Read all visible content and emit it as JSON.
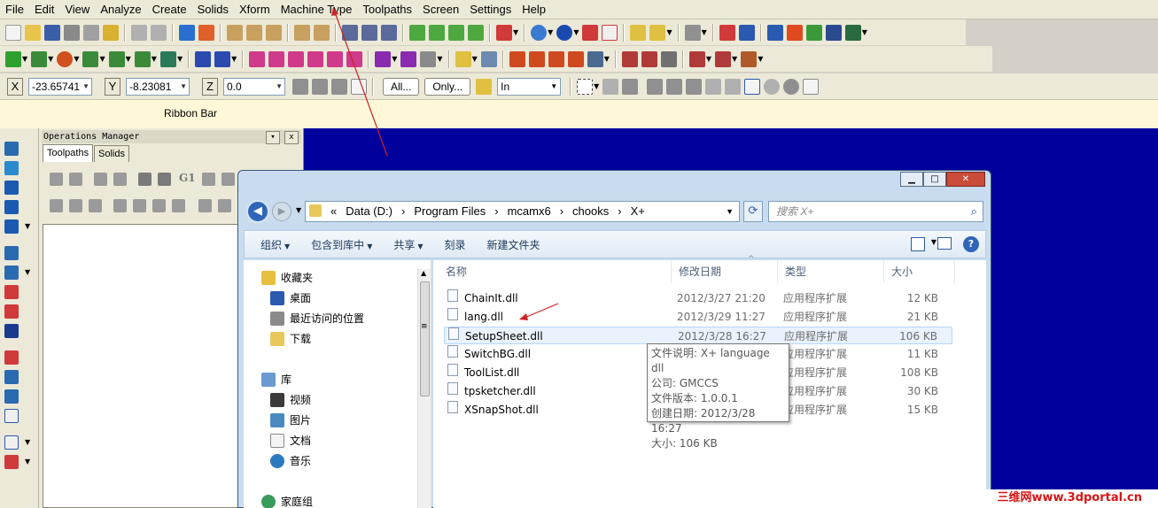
{
  "menubar": [
    "File",
    "Edit",
    "View",
    "Analyze",
    "Create",
    "Solids",
    "Xform",
    "Machine Type",
    "Toolpaths",
    "Screen",
    "Settings",
    "Help"
  ],
  "ribbon": {
    "x_label": "X",
    "x_value": "-23.65741",
    "y_label": "Y",
    "y_value": "-8.23081",
    "z_label": "Z",
    "z_value": "0.0",
    "all_button": "All...",
    "only_button": "Only...",
    "mode_value": "In",
    "bar_label": "Ribbon Bar"
  },
  "ops": {
    "title": "Operations Manager",
    "pin": "▾",
    "close": "x",
    "tabs": [
      "Toolpaths",
      "Solids"
    ],
    "g1_label": "G1"
  },
  "explorer": {
    "address": [
      "«",
      "Data (D:)",
      "›",
      "Program Files",
      "›",
      "mcamx6",
      "›",
      "chooks",
      "›",
      "X+"
    ],
    "search_placeholder": "搜索 X+",
    "commands": [
      "组织",
      "包含到库中",
      "共享",
      "刻录",
      "新建文件夹"
    ],
    "nav": {
      "favorites": "收藏夹",
      "desktop": "桌面",
      "recent": "最近访问的位置",
      "downloads": "下载",
      "libraries": "库",
      "videos": "视频",
      "pictures": "图片",
      "documents": "文档",
      "music": "音乐",
      "homegroup": "家庭组"
    },
    "columns": [
      "名称",
      "修改日期",
      "类型",
      "大小"
    ],
    "files": [
      {
        "name": "ChainIt.dll",
        "date": "2012/3/27 21:20",
        "type": "应用程序扩展",
        "size": "12 KB"
      },
      {
        "name": "lang.dll",
        "date": "2012/3/29 11:27",
        "type": "应用程序扩展",
        "size": "21 KB"
      },
      {
        "name": "SetupSheet.dll",
        "date": "2012/3/28 16:27",
        "type": "应用程序扩展",
        "size": "106 KB"
      },
      {
        "name": "SwitchBG.dll",
        "date": "",
        "type": "应用程序扩展",
        "size": "11 KB"
      },
      {
        "name": "ToolList.dll",
        "date": "",
        "type": "应用程序扩展",
        "size": "108 KB"
      },
      {
        "name": "tpsketcher.dll",
        "date": "",
        "type": "应用程序扩展",
        "size": "30 KB"
      },
      {
        "name": "XSnapShot.dll",
        "date": "",
        "type": "应用程序扩展",
        "size": "15 KB"
      }
    ],
    "tooltip": [
      "文件说明: X+ language dll",
      "公司: GMCCS",
      "文件版本: 1.0.0.1",
      "创建日期: 2012/3/28 16:27",
      "大小: 106 KB"
    ]
  },
  "watermark": "三维网www.3dportal.cn",
  "colors": {
    "graphics_bg": "#00009c",
    "ribbon_bar_bg": "#fff8d8",
    "annotation_arrow": "#cc2222"
  }
}
